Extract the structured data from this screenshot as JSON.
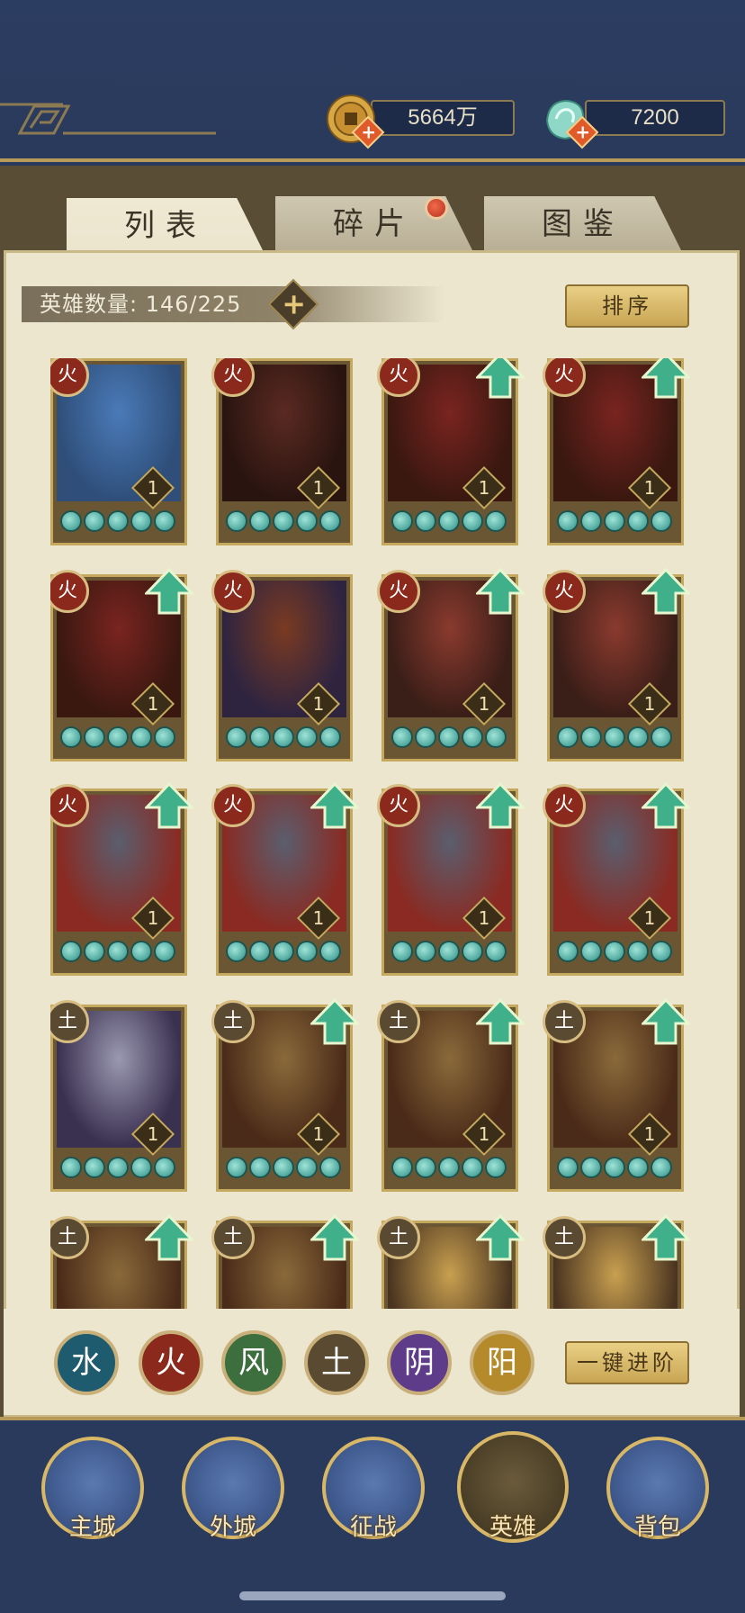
{
  "currencies": [
    {
      "name": "coin-icon",
      "value": "5664万"
    },
    {
      "name": "jade-icon",
      "value": "7200"
    }
  ],
  "tabs": [
    {
      "label": "列表",
      "active": true
    },
    {
      "label": "碎片",
      "active": false,
      "badge": true
    },
    {
      "label": "图鉴",
      "active": false
    }
  ],
  "hero_count": {
    "label": "英雄数量:",
    "value": "146/225"
  },
  "sort_label": "排序",
  "heroes": [
    {
      "element": "fire",
      "element_glyph": "火",
      "level": "1",
      "upgrade": false,
      "hero": "scholar-hero"
    },
    {
      "element": "fire",
      "element_glyph": "火",
      "level": "1",
      "upgrade": false,
      "hero": "hat-swordsman"
    },
    {
      "element": "fire",
      "element_glyph": "火",
      "level": "1",
      "upgrade": true,
      "hero": "white-hair-hero"
    },
    {
      "element": "fire",
      "element_glyph": "火",
      "level": "1",
      "upgrade": true,
      "hero": "white-hair-hero"
    },
    {
      "element": "fire",
      "element_glyph": "火",
      "level": "1",
      "upgrade": true,
      "hero": "white-hair-hero"
    },
    {
      "element": "fire",
      "element_glyph": "火",
      "level": "1",
      "upgrade": false,
      "hero": "red-hair-hero"
    },
    {
      "element": "fire",
      "element_glyph": "火",
      "level": "1",
      "upgrade": true,
      "hero": "veiled-lady"
    },
    {
      "element": "fire",
      "element_glyph": "火",
      "level": "1",
      "upgrade": true,
      "hero": "veiled-lady"
    },
    {
      "element": "fire",
      "element_glyph": "火",
      "level": "1",
      "upgrade": true,
      "hero": "bearded-warrior"
    },
    {
      "element": "fire",
      "element_glyph": "火",
      "level": "1",
      "upgrade": true,
      "hero": "bearded-warrior"
    },
    {
      "element": "fire",
      "element_glyph": "火",
      "level": "1",
      "upgrade": true,
      "hero": "bearded-warrior"
    },
    {
      "element": "fire",
      "element_glyph": "火",
      "level": "1",
      "upgrade": true,
      "hero": "bearded-warrior"
    },
    {
      "element": "earth",
      "element_glyph": "土",
      "level": "1",
      "upgrade": false,
      "hero": "silver-hair-lady"
    },
    {
      "element": "earth",
      "element_glyph": "土",
      "level": "1",
      "upgrade": true,
      "hero": "armored-general"
    },
    {
      "element": "earth",
      "element_glyph": "土",
      "level": "1",
      "upgrade": true,
      "hero": "armored-general"
    },
    {
      "element": "earth",
      "element_glyph": "土",
      "level": "1",
      "upgrade": true,
      "hero": "armored-general"
    },
    {
      "element": "earth",
      "element_glyph": "土",
      "level": "",
      "upgrade": true,
      "hero": "armored-general"
    },
    {
      "element": "earth",
      "element_glyph": "土",
      "level": "",
      "upgrade": true,
      "hero": "armored-general"
    },
    {
      "element": "earth",
      "element_glyph": "土",
      "level": "",
      "upgrade": true,
      "hero": "golden-lady"
    },
    {
      "element": "earth",
      "element_glyph": "土",
      "level": "",
      "upgrade": true,
      "hero": "golden-lady"
    }
  ],
  "filters": [
    {
      "element": "water",
      "glyph": "水"
    },
    {
      "element": "fire",
      "glyph": "火"
    },
    {
      "element": "wind",
      "glyph": "风"
    },
    {
      "element": "earth",
      "glyph": "土"
    },
    {
      "element": "yin",
      "glyph": "阴"
    },
    {
      "element": "yang",
      "glyph": "阳"
    }
  ],
  "one_click_label": "一键进阶",
  "nav": [
    {
      "label": "主城",
      "icon": "main-city-icon",
      "active": false
    },
    {
      "label": "外城",
      "icon": "outer-city-icon",
      "active": false
    },
    {
      "label": "征战",
      "icon": "campaign-icon",
      "active": false
    },
    {
      "label": "英雄",
      "icon": "hero-icon",
      "active": true
    },
    {
      "label": "背包",
      "icon": "backpack-icon",
      "active": false
    }
  ],
  "colors": {
    "accent_gold": "#c3a85e",
    "panel": "#ece6cf",
    "navy": "#2a3a5c",
    "star_teal": "#2e8f85"
  }
}
